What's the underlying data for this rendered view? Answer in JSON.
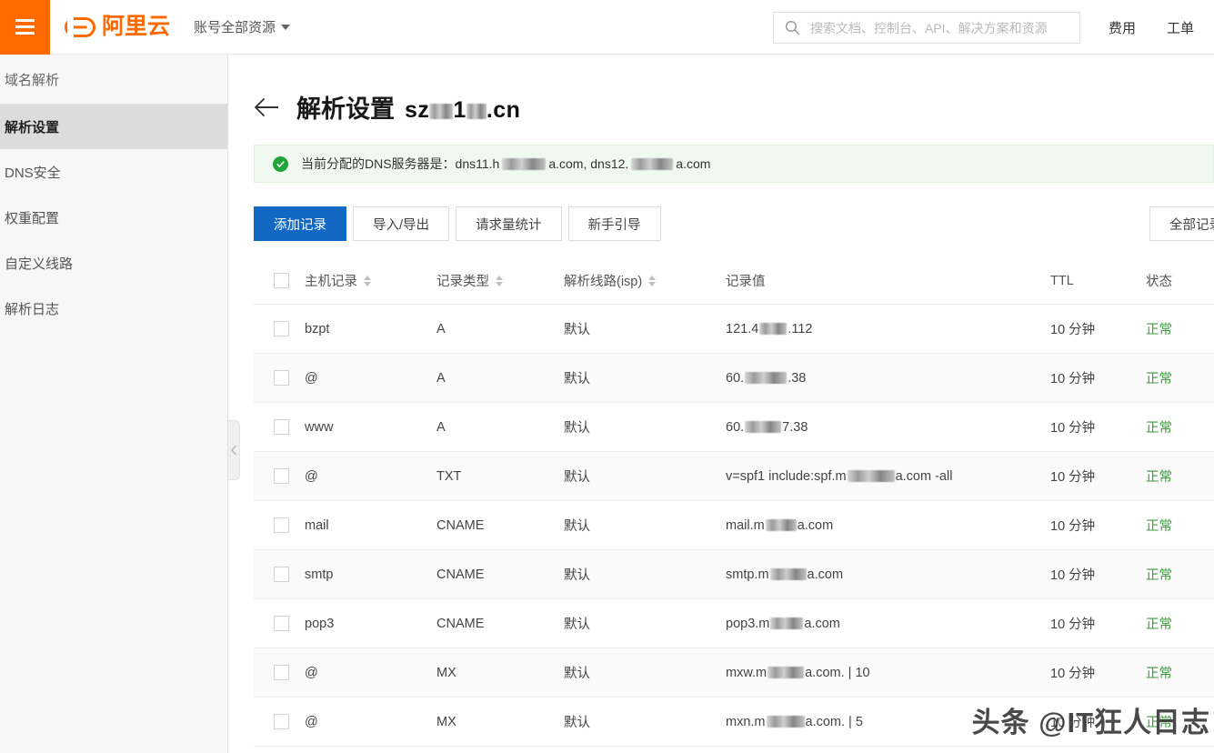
{
  "header": {
    "menu_icon": "hamburger-icon",
    "brand": "阿里云",
    "account_scope": "账号全部资源",
    "search_placeholder": "搜索文档、控制台、API、解决方案和资源",
    "search_value": "",
    "nav": [
      {
        "label": "费用"
      },
      {
        "label": "工单"
      }
    ]
  },
  "sidebar": {
    "section_title": "域名解析",
    "items": [
      {
        "label": "解析设置",
        "active": true
      },
      {
        "label": "DNS安全",
        "active": false
      },
      {
        "label": "权重配置",
        "active": false
      },
      {
        "label": "自定义线路",
        "active": false
      },
      {
        "label": "解析日志",
        "active": false
      }
    ],
    "collapse_icon": "chevron-left-icon"
  },
  "page": {
    "back_icon": "arrow-left-icon",
    "title": "解析设置",
    "domain_prefix": "sz",
    "domain_mid": "1",
    "domain_suffix": ".cn",
    "notice_icon": "check-circle-icon",
    "notice_prefix": "当前分配的DNS服务器是：dns11.h",
    "notice_mid": "a.com, dns12.",
    "notice_suffix": "a.com"
  },
  "toolbar": {
    "add_record": "添加记录",
    "import_export": "导入/导出",
    "request_stats": "请求量统计",
    "beginner_guide": "新手引导",
    "all_records": "全部记录"
  },
  "table": {
    "columns": [
      {
        "label": "主机记录",
        "sortable": true
      },
      {
        "label": "记录类型",
        "sortable": true
      },
      {
        "label": "解析线路(isp)",
        "sortable": true
      },
      {
        "label": "记录值",
        "sortable": false
      },
      {
        "label": "TTL",
        "sortable": false
      },
      {
        "label": "状态",
        "sortable": false
      }
    ],
    "rows": [
      {
        "host": "bzpt",
        "type": "A",
        "line": "默认",
        "value_pre": "121.4",
        "value_post": ".112",
        "ttl": "10 分钟",
        "status": "正常"
      },
      {
        "host": "@",
        "type": "A",
        "line": "默认",
        "value_pre": "60.",
        "value_post": ".38",
        "ttl": "10 分钟",
        "status": "正常"
      },
      {
        "host": "www",
        "type": "A",
        "line": "默认",
        "value_pre": "60.",
        "value_post": "7.38",
        "ttl": "10 分钟",
        "status": "正常"
      },
      {
        "host": "@",
        "type": "TXT",
        "line": "默认",
        "value_pre": "v=spf1 include:spf.m",
        "value_post": "a.com -all",
        "ttl": "10 分钟",
        "status": "正常"
      },
      {
        "host": "mail",
        "type": "CNAME",
        "line": "默认",
        "value_pre": "mail.m",
        "value_post": "a.com",
        "ttl": "10 分钟",
        "status": "正常"
      },
      {
        "host": "smtp",
        "type": "CNAME",
        "line": "默认",
        "value_pre": "smtp.m",
        "value_post": "a.com",
        "ttl": "10 分钟",
        "status": "正常"
      },
      {
        "host": "pop3",
        "type": "CNAME",
        "line": "默认",
        "value_pre": "pop3.m",
        "value_post": "a.com",
        "ttl": "10 分钟",
        "status": "正常"
      },
      {
        "host": "@",
        "type": "MX",
        "line": "默认",
        "value_pre": "mxw.m",
        "value_post": "a.com. | 10",
        "ttl": "10 分钟",
        "status": "正常"
      },
      {
        "host": "@",
        "type": "MX",
        "line": "默认",
        "value_pre": "mxn.m",
        "value_post": "a.com. | 5",
        "ttl": "10 分钟",
        "status": "正常"
      }
    ]
  },
  "watermark": {
    "text": "头条 @IT狂人日志"
  },
  "colors": {
    "brand_orange": "#ff6a00",
    "primary_blue": "#1268c3",
    "status_green": "#3c9c3c",
    "notice_bg": "#f0f9f0",
    "sidebar_bg": "#f7f7f7",
    "sidebar_active": "#dcdcdc"
  }
}
